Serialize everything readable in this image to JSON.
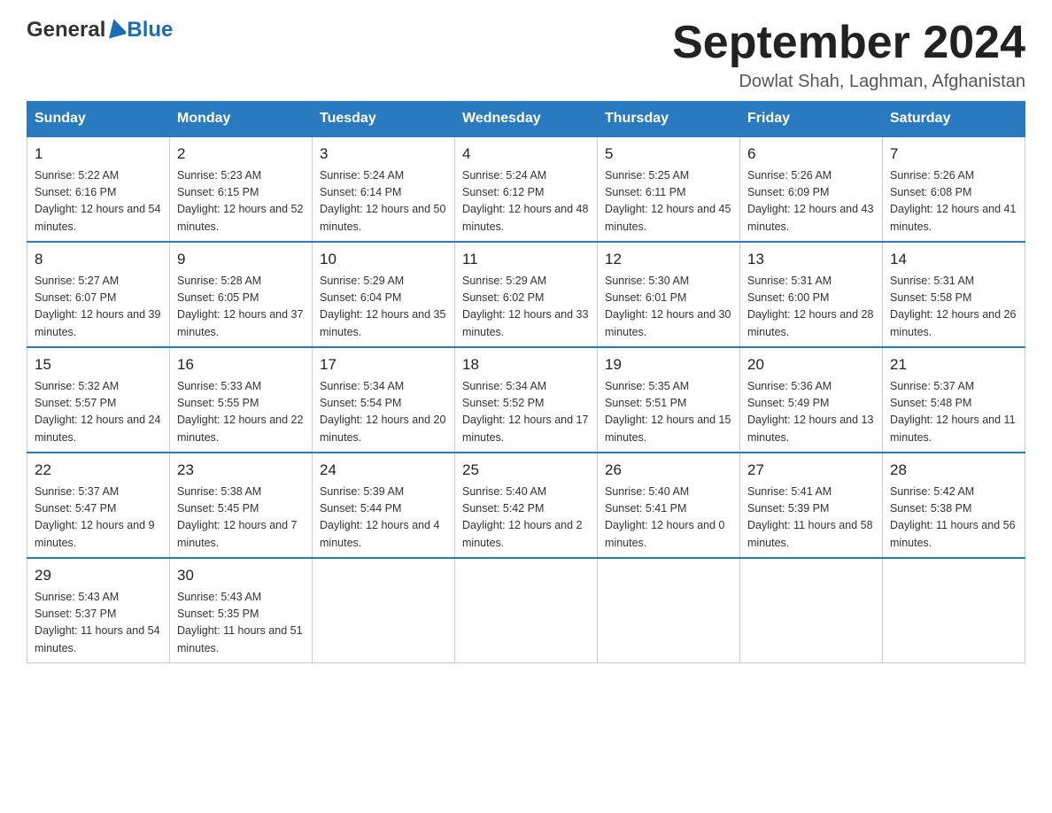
{
  "header": {
    "logo_general": "General",
    "logo_blue": "Blue",
    "month_title": "September 2024",
    "location": "Dowlat Shah, Laghman, Afghanistan"
  },
  "weekdays": [
    "Sunday",
    "Monday",
    "Tuesday",
    "Wednesday",
    "Thursday",
    "Friday",
    "Saturday"
  ],
  "weeks": [
    [
      {
        "day": "1",
        "sunrise": "Sunrise: 5:22 AM",
        "sunset": "Sunset: 6:16 PM",
        "daylight": "Daylight: 12 hours and 54 minutes."
      },
      {
        "day": "2",
        "sunrise": "Sunrise: 5:23 AM",
        "sunset": "Sunset: 6:15 PM",
        "daylight": "Daylight: 12 hours and 52 minutes."
      },
      {
        "day": "3",
        "sunrise": "Sunrise: 5:24 AM",
        "sunset": "Sunset: 6:14 PM",
        "daylight": "Daylight: 12 hours and 50 minutes."
      },
      {
        "day": "4",
        "sunrise": "Sunrise: 5:24 AM",
        "sunset": "Sunset: 6:12 PM",
        "daylight": "Daylight: 12 hours and 48 minutes."
      },
      {
        "day": "5",
        "sunrise": "Sunrise: 5:25 AM",
        "sunset": "Sunset: 6:11 PM",
        "daylight": "Daylight: 12 hours and 45 minutes."
      },
      {
        "day": "6",
        "sunrise": "Sunrise: 5:26 AM",
        "sunset": "Sunset: 6:09 PM",
        "daylight": "Daylight: 12 hours and 43 minutes."
      },
      {
        "day": "7",
        "sunrise": "Sunrise: 5:26 AM",
        "sunset": "Sunset: 6:08 PM",
        "daylight": "Daylight: 12 hours and 41 minutes."
      }
    ],
    [
      {
        "day": "8",
        "sunrise": "Sunrise: 5:27 AM",
        "sunset": "Sunset: 6:07 PM",
        "daylight": "Daylight: 12 hours and 39 minutes."
      },
      {
        "day": "9",
        "sunrise": "Sunrise: 5:28 AM",
        "sunset": "Sunset: 6:05 PM",
        "daylight": "Daylight: 12 hours and 37 minutes."
      },
      {
        "day": "10",
        "sunrise": "Sunrise: 5:29 AM",
        "sunset": "Sunset: 6:04 PM",
        "daylight": "Daylight: 12 hours and 35 minutes."
      },
      {
        "day": "11",
        "sunrise": "Sunrise: 5:29 AM",
        "sunset": "Sunset: 6:02 PM",
        "daylight": "Daylight: 12 hours and 33 minutes."
      },
      {
        "day": "12",
        "sunrise": "Sunrise: 5:30 AM",
        "sunset": "Sunset: 6:01 PM",
        "daylight": "Daylight: 12 hours and 30 minutes."
      },
      {
        "day": "13",
        "sunrise": "Sunrise: 5:31 AM",
        "sunset": "Sunset: 6:00 PM",
        "daylight": "Daylight: 12 hours and 28 minutes."
      },
      {
        "day": "14",
        "sunrise": "Sunrise: 5:31 AM",
        "sunset": "Sunset: 5:58 PM",
        "daylight": "Daylight: 12 hours and 26 minutes."
      }
    ],
    [
      {
        "day": "15",
        "sunrise": "Sunrise: 5:32 AM",
        "sunset": "Sunset: 5:57 PM",
        "daylight": "Daylight: 12 hours and 24 minutes."
      },
      {
        "day": "16",
        "sunrise": "Sunrise: 5:33 AM",
        "sunset": "Sunset: 5:55 PM",
        "daylight": "Daylight: 12 hours and 22 minutes."
      },
      {
        "day": "17",
        "sunrise": "Sunrise: 5:34 AM",
        "sunset": "Sunset: 5:54 PM",
        "daylight": "Daylight: 12 hours and 20 minutes."
      },
      {
        "day": "18",
        "sunrise": "Sunrise: 5:34 AM",
        "sunset": "Sunset: 5:52 PM",
        "daylight": "Daylight: 12 hours and 17 minutes."
      },
      {
        "day": "19",
        "sunrise": "Sunrise: 5:35 AM",
        "sunset": "Sunset: 5:51 PM",
        "daylight": "Daylight: 12 hours and 15 minutes."
      },
      {
        "day": "20",
        "sunrise": "Sunrise: 5:36 AM",
        "sunset": "Sunset: 5:49 PM",
        "daylight": "Daylight: 12 hours and 13 minutes."
      },
      {
        "day": "21",
        "sunrise": "Sunrise: 5:37 AM",
        "sunset": "Sunset: 5:48 PM",
        "daylight": "Daylight: 12 hours and 11 minutes."
      }
    ],
    [
      {
        "day": "22",
        "sunrise": "Sunrise: 5:37 AM",
        "sunset": "Sunset: 5:47 PM",
        "daylight": "Daylight: 12 hours and 9 minutes."
      },
      {
        "day": "23",
        "sunrise": "Sunrise: 5:38 AM",
        "sunset": "Sunset: 5:45 PM",
        "daylight": "Daylight: 12 hours and 7 minutes."
      },
      {
        "day": "24",
        "sunrise": "Sunrise: 5:39 AM",
        "sunset": "Sunset: 5:44 PM",
        "daylight": "Daylight: 12 hours and 4 minutes."
      },
      {
        "day": "25",
        "sunrise": "Sunrise: 5:40 AM",
        "sunset": "Sunset: 5:42 PM",
        "daylight": "Daylight: 12 hours and 2 minutes."
      },
      {
        "day": "26",
        "sunrise": "Sunrise: 5:40 AM",
        "sunset": "Sunset: 5:41 PM",
        "daylight": "Daylight: 12 hours and 0 minutes."
      },
      {
        "day": "27",
        "sunrise": "Sunrise: 5:41 AM",
        "sunset": "Sunset: 5:39 PM",
        "daylight": "Daylight: 11 hours and 58 minutes."
      },
      {
        "day": "28",
        "sunrise": "Sunrise: 5:42 AM",
        "sunset": "Sunset: 5:38 PM",
        "daylight": "Daylight: 11 hours and 56 minutes."
      }
    ],
    [
      {
        "day": "29",
        "sunrise": "Sunrise: 5:43 AM",
        "sunset": "Sunset: 5:37 PM",
        "daylight": "Daylight: 11 hours and 54 minutes."
      },
      {
        "day": "30",
        "sunrise": "Sunrise: 5:43 AM",
        "sunset": "Sunset: 5:35 PM",
        "daylight": "Daylight: 11 hours and 51 minutes."
      },
      null,
      null,
      null,
      null,
      null
    ]
  ]
}
